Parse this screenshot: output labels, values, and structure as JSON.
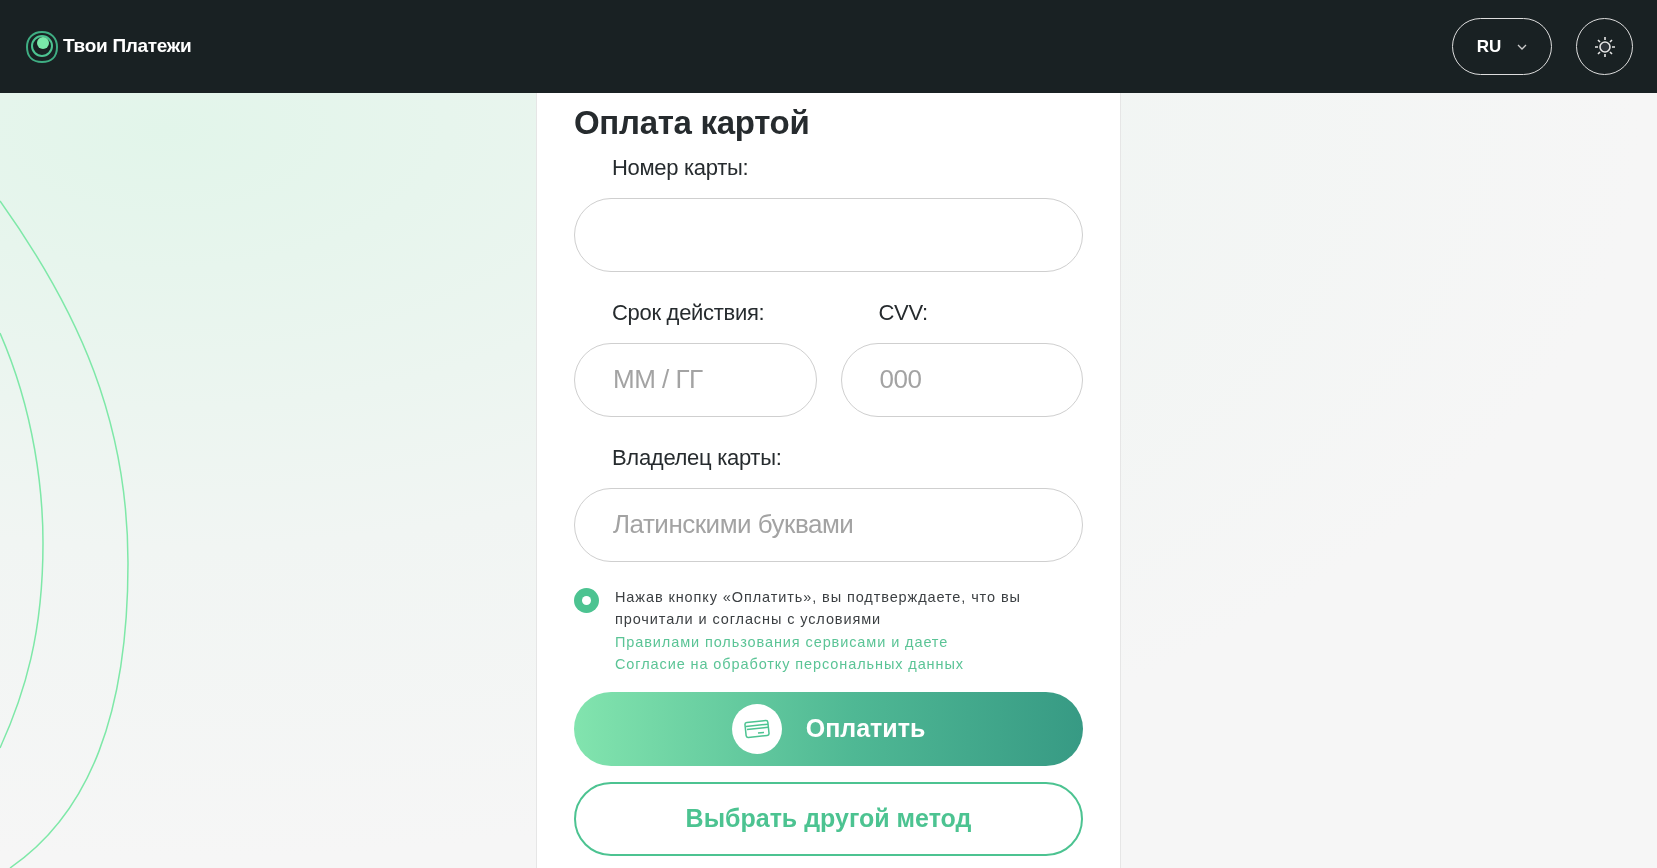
{
  "header": {
    "logo_text": "Твои Платежи",
    "language": {
      "label": "RU"
    },
    "theme_button": {
      "kind": "sun"
    }
  },
  "form": {
    "title": "Оплата картой",
    "fields": [
      {
        "label": "Номер карты:"
      },
      {
        "label": "Срок действия:",
        "placeholder": "ММ / ГГ"
      },
      {
        "label": "CVV:",
        "placeholder": "000"
      },
      {
        "label": "Владелец карты:",
        "placeholder": "Латинскими буквами"
      }
    ],
    "consent": {
      "checked": true,
      "text": "Нажав кнопку «Оплатить», вы подтверждаете, что вы прочитали и согласны с условиями ",
      "links": [
        "Правилами пользования сервисами",
        "Согласие на обработку персональных данных"
      ],
      "joiner": " и даете "
    },
    "pay_button": {
      "label": "Оплатить"
    },
    "other_method_button": {
      "label": "Выбрать другой метод"
    }
  }
}
